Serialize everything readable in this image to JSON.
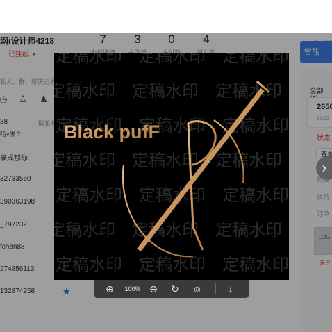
{
  "app": {
    "shop_name": "网i设计师4218",
    "shop_status": "已挂起",
    "stats": [
      {
        "value": "7",
        "label": "今日接待"
      },
      {
        "value": "3",
        "label": "未下单"
      },
      {
        "value": "0",
        "label": "未付款"
      },
      {
        "value": "4",
        "label": "已付款"
      }
    ],
    "search_hint": "私人、群、聊天记录",
    "link_label": "联系与",
    "contacts": [
      {
        "text": "38"
      },
      {
        "text": "哈v发个"
      },
      {
        "text": "录成那你"
      },
      {
        "text": "32733550"
      },
      {
        "text": "390363198"
      },
      {
        "text": "_797232"
      },
      {
        "text": "fchen88"
      },
      {
        "text": "274856113"
      },
      {
        "text": "132874258"
      }
    ],
    "right": {
      "header_button": "智能",
      "all_label": "全部(3)",
      "order_no": "2656",
      "order_date": "2022",
      "status": "状态",
      "look_button": "查看",
      "field_1": "购买",
      "field_2": "收货",
      "field_3": "订单",
      "thumb_text": "LOG",
      "thumb_caption": "未评"
    }
  },
  "viewer": {
    "watermark_text": "定稿水印",
    "logo_text": "Black pufF",
    "zoom_level": "100%",
    "toolbar_icons": [
      "zoom-in-icon",
      "zoom-out-icon",
      "rotate-icon",
      "emoji-icon",
      "download-icon"
    ],
    "colors": {
      "background": "#000000",
      "logo_gold": "#c9955e",
      "watermark": "#2a2a2a"
    }
  }
}
